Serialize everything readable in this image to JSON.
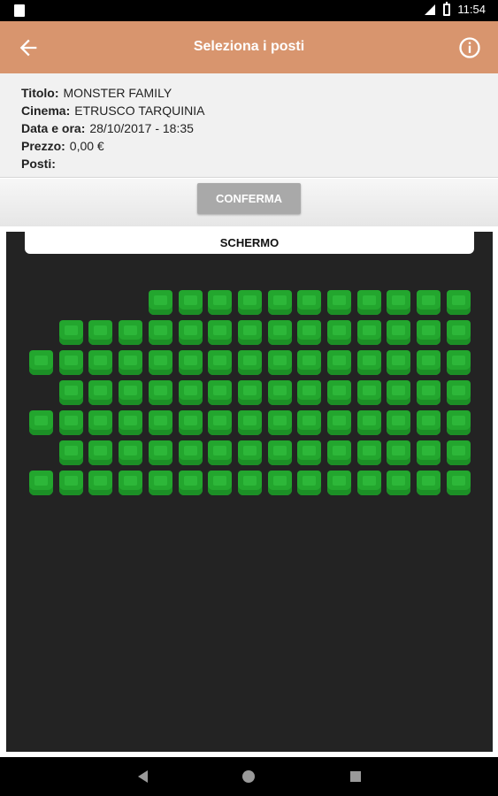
{
  "status_bar": {
    "time": "11:54"
  },
  "app_bar": {
    "title": "Seleziona i posti"
  },
  "details": {
    "titolo_label": "Titolo:",
    "titolo_value": "MONSTER FAMILY",
    "cinema_label": "Cinema:",
    "cinema_value": "ETRUSCO TARQUINIA",
    "data_label": "Data e ora:",
    "data_value": "28/10/2017 - 18:35",
    "prezzo_label": "Prezzo:",
    "prezzo_value": "0,00 €",
    "posti_label": "Posti:",
    "posti_value": ""
  },
  "confirm_label": "CONFERMA",
  "hall": {
    "screen_label": "SCHERMO",
    "seat_color": "#23a62e",
    "rows": [
      [
        0,
        0,
        0,
        0,
        1,
        1,
        1,
        1,
        1,
        1,
        1,
        1,
        1,
        1,
        1
      ],
      [
        0,
        1,
        1,
        1,
        1,
        1,
        1,
        1,
        1,
        1,
        1,
        1,
        1,
        1,
        1
      ],
      [
        1,
        1,
        1,
        1,
        1,
        1,
        1,
        1,
        1,
        1,
        1,
        1,
        1,
        1,
        1
      ],
      [
        0,
        1,
        1,
        1,
        1,
        1,
        1,
        1,
        1,
        1,
        1,
        1,
        1,
        1,
        1
      ],
      [
        1,
        1,
        1,
        1,
        1,
        1,
        1,
        1,
        1,
        1,
        1,
        1,
        1,
        1,
        1
      ],
      [
        0,
        1,
        1,
        1,
        1,
        1,
        1,
        1,
        1,
        1,
        1,
        1,
        1,
        1,
        1
      ],
      [
        1,
        1,
        1,
        1,
        1,
        1,
        1,
        1,
        1,
        1,
        1,
        1,
        1,
        1,
        1
      ]
    ]
  }
}
